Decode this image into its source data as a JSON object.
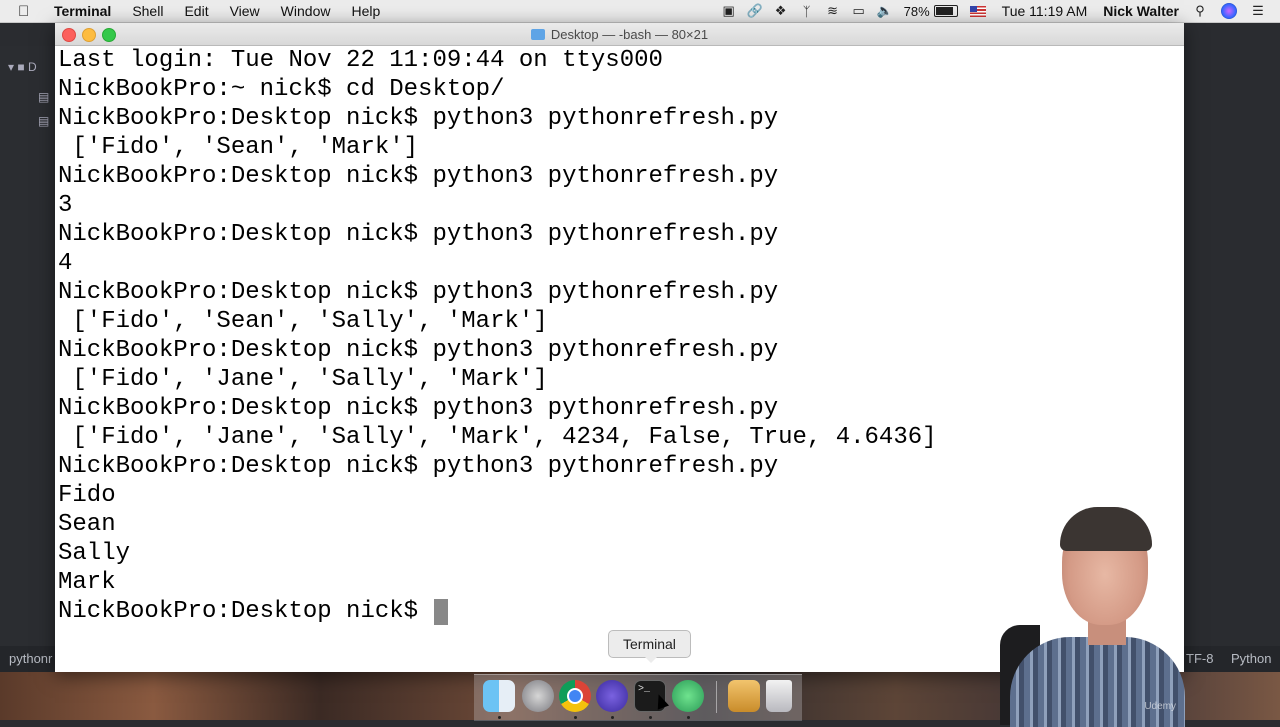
{
  "menubar": {
    "app_name": "Terminal",
    "menus": [
      "Shell",
      "Edit",
      "View",
      "Window",
      "Help"
    ],
    "battery_percent": "78%",
    "clock": "Tue 11:19 AM",
    "user": "Nick Walter",
    "tray_icons": [
      "screen-record-icon",
      "link-icon",
      "dropbox-icon",
      "bluetooth-icon",
      "wifi-icon",
      "airplay-icon",
      "volume-icon",
      "battery-icon",
      "us-flag-icon",
      "search-icon",
      "siri-icon",
      "notification-center-icon"
    ]
  },
  "terminal": {
    "window_title": "Desktop — -bash — 80×21",
    "lines": [
      "Last login: Tue Nov 22 11:09:44 on ttys000",
      "NickBookPro:~ nick$ cd Desktop/",
      "NickBookPro:Desktop nick$ python3 pythonrefresh.py",
      " ['Fido', 'Sean', 'Mark']",
      "NickBookPro:Desktop nick$ python3 pythonrefresh.py",
      "3",
      "NickBookPro:Desktop nick$ python3 pythonrefresh.py",
      "4",
      "NickBookPro:Desktop nick$ python3 pythonrefresh.py",
      " ['Fido', 'Sean', 'Sally', 'Mark']",
      "NickBookPro:Desktop nick$ python3 pythonrefresh.py",
      " ['Fido', 'Jane', 'Sally', 'Mark']",
      "NickBookPro:Desktop nick$ python3 pythonrefresh.py",
      " ['Fido', 'Jane', 'Sally', 'Mark', 4234, False, True, 4.6436]",
      "NickBookPro:Desktop nick$ python3 pythonrefresh.py",
      "Fido",
      "Sean",
      "Sally",
      "Mark"
    ],
    "current_prompt": "NickBookPro:Desktop nick$ "
  },
  "background_editor": {
    "status_left": "pythonr",
    "encoding": "TF-8",
    "language": "Python",
    "sidebar_label": "D"
  },
  "tooltip": {
    "text": "Terminal"
  },
  "dock": {
    "items": [
      "finder-icon",
      "launchpad-icon",
      "chrome-icon",
      "imovie-icon",
      "terminal-icon",
      "atom-icon",
      "archive-icon",
      "trash-icon"
    ],
    "terminal_glyph": ">_"
  },
  "watermark": "Udemy"
}
